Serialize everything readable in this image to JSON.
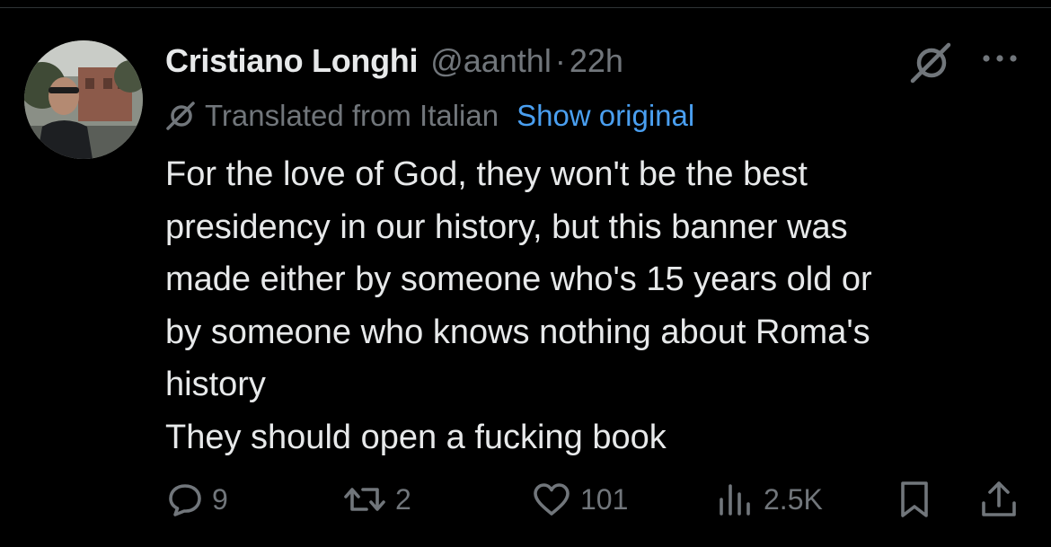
{
  "post": {
    "display_name": "Cristiano Longhi",
    "handle": "@aanthl",
    "separator": "·",
    "time": "22h",
    "translation_note": "Translated from Italian",
    "show_original_label": "Show original",
    "text": "For the love of God, they won't be the best\npresidency in our history, but this banner was\nmade either by someone who's 15 years old or\nby someone who knows nothing about Roma's\nhistory\nThey should open a fucking book"
  },
  "actions": {
    "replies": "9",
    "reposts": "2",
    "likes": "101",
    "views": "2.5K"
  },
  "icons": {
    "reply": "reply-icon",
    "repost": "repost-icon",
    "like": "heart-icon",
    "views": "views-icon",
    "bookmark": "bookmark-icon",
    "share": "share-icon",
    "grok": "grok-icon",
    "more": "more-icon",
    "translate": "translate-icon"
  },
  "colors": {
    "background": "#000000",
    "text_primary": "#e7e9ea",
    "text_secondary": "#71767b",
    "link": "#4a9ff0",
    "divider": "#2f3336"
  }
}
